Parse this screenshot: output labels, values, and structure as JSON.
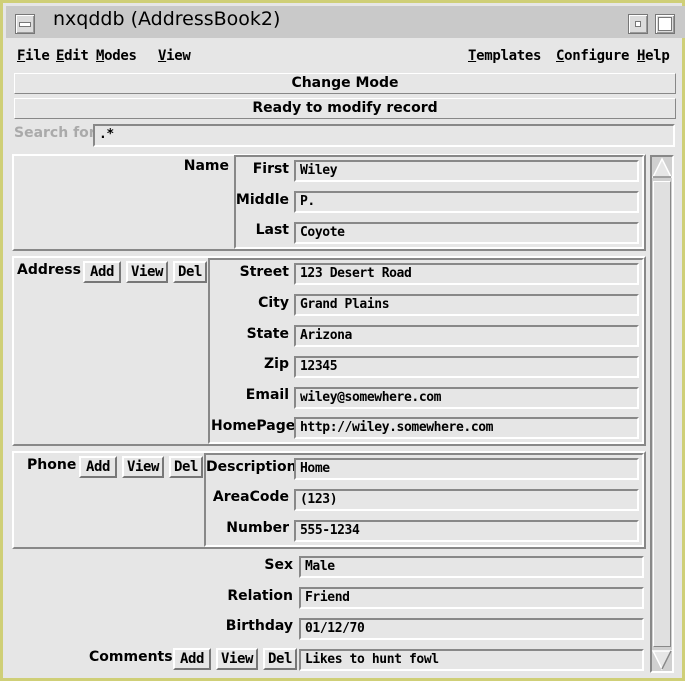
{
  "window": {
    "title": "nxqddb (AddressBook2)"
  },
  "menu": {
    "file": "File",
    "edit": "Edit",
    "modes": "Modes",
    "view": "View",
    "templates": "Templates",
    "configure": "Configure",
    "help": "Help"
  },
  "mode_button": "Change Mode",
  "status": "Ready to modify record",
  "search": {
    "label": "Search for",
    "value": ".*"
  },
  "name": {
    "section": "Name",
    "first_label": "First",
    "first": "Wiley",
    "middle_label": "Middle",
    "middle": "P.",
    "last_label": "Last",
    "last": "Coyote"
  },
  "address": {
    "section": "Address",
    "add": "Add",
    "view": "View",
    "del": "Del",
    "street_label": "Street",
    "street": "123 Desert Road",
    "city_label": "City",
    "city": "Grand Plains",
    "state_label": "State",
    "state": "Arizona",
    "zip_label": "Zip",
    "zip": "12345",
    "email_label": "Email",
    "email": "wiley@somewhere.com",
    "homepage_label": "HomePage",
    "homepage": "http://wiley.somewhere.com"
  },
  "phone": {
    "section": "Phone",
    "add": "Add",
    "view": "View",
    "del": "Del",
    "description_label": "Description",
    "description": "Home",
    "areacode_label": "AreaCode",
    "areacode": "(123)",
    "number_label": "Number",
    "number": "555-1234"
  },
  "misc": {
    "sex_label": "Sex",
    "sex": "Male",
    "relation_label": "Relation",
    "relation": "Friend",
    "birthday_label": "Birthday",
    "birthday": "01/12/70",
    "comments_label": "Comments",
    "add": "Add",
    "view": "View",
    "del": "Del",
    "comments": "Likes to hunt fowl"
  }
}
